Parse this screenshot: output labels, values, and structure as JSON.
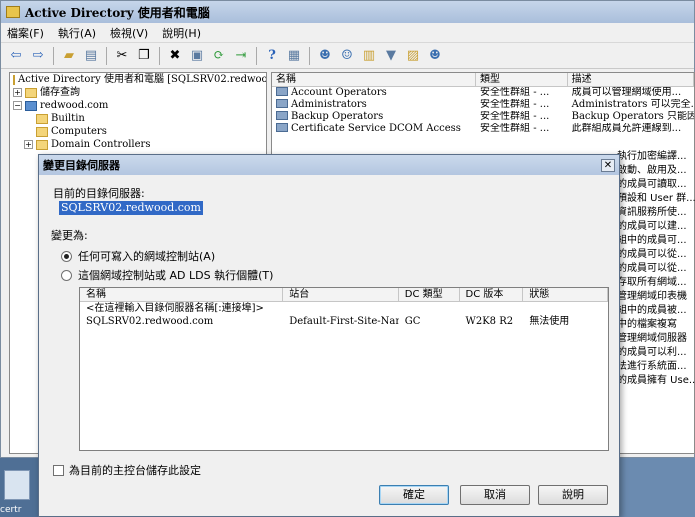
{
  "window": {
    "title": "Active Directory 使用者和電腦"
  },
  "menu": [
    "檔案(F)",
    "執行(A)",
    "檢視(V)",
    "說明(H)"
  ],
  "tree": [
    {
      "label": "Active Directory 使用者和電腦 [SQLSRV02.redwoo",
      "indent": 0,
      "expander": ""
    },
    {
      "label": "儲存查詢",
      "indent": 1,
      "expander": "+"
    },
    {
      "label": "redwood.com",
      "indent": 1,
      "expander": "−"
    },
    {
      "label": "Builtin",
      "indent": 2,
      "expander": ""
    },
    {
      "label": "Computers",
      "indent": 2,
      "expander": ""
    },
    {
      "label": "Domain Controllers",
      "indent": 2,
      "expander": "+"
    }
  ],
  "list": {
    "headers": [
      "名稱",
      "類型",
      "描述"
    ],
    "rows": [
      {
        "name": "Account Operators",
        "type": "安全性群組 - ...",
        "desc": "成員可以管理網域使用..."
      },
      {
        "name": "Administrators",
        "type": "安全性群組 - ...",
        "desc": "Administrators 可以完全..."
      },
      {
        "name": "Backup Operators",
        "type": "安全性群組 - ...",
        "desc": "Backup Operators 只能因..."
      },
      {
        "name": "Certificate Service DCOM Access",
        "type": "安全性群組 - ...",
        "desc": "此群組成員允許連線到..."
      }
    ],
    "desc_continued": [
      "執行加密編譯...",
      "啟動、啟用及...",
      "的成員可讀取...",
      "預設和 User 群...",
      "資訊服務所使...",
      "的成員可以建...",
      "組中的成員可...",
      "的成員可以從...",
      "的成員可以從...",
      "存取所有網域...",
      "管理網域印表機",
      "組中的成員被...",
      "中的檔案複寫",
      "管理網域伺服器",
      "的成員可以利...",
      "法進行系統面...",
      "的成員擁有 Use..."
    ]
  },
  "dialog": {
    "title": "變更目錄伺服器",
    "current_label": "目前的目錄伺服器:",
    "current_server": "SQLSRV02.redwood.com",
    "change_label": "變更為:",
    "radio1": "任何可寫入的網域控制站(A)",
    "radio2": "這個網域控制站或 AD LDS 執行個體(T)",
    "table": {
      "headers": [
        "名稱",
        "站台",
        "DC 類型",
        "DC 版本",
        "狀態"
      ],
      "placeholder_row": "<在這裡輸入目錄伺服器名稱[:連接埠]>",
      "rows": [
        {
          "name": "SQLSRV02.redwood.com",
          "site": "Default-First-Site-Name",
          "dc_type": "GC",
          "dc_version": "W2K8 R2",
          "status": "無法使用"
        }
      ]
    },
    "save_checkbox": "為目前的主控台儲存此設定",
    "ok": "確定",
    "cancel": "取消",
    "help": "說明"
  },
  "taskbar": {
    "label": "certr"
  }
}
